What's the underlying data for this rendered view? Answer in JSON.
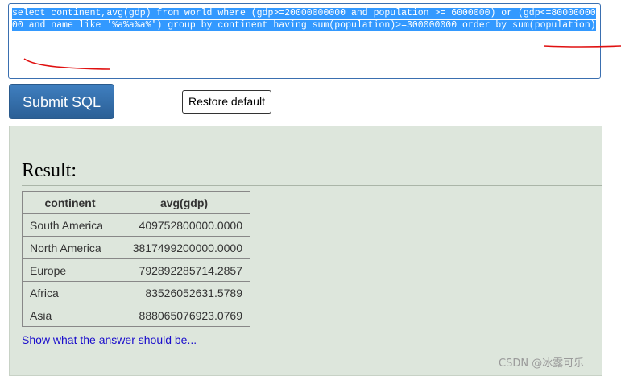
{
  "sql": {
    "query": "select continent,avg(gdp) from world where (gdp>=20000000000 and population >= 6000000) or (gdp<=8000000000 and name like '%a%a%a%') group by continent having sum(population)>=300000000 order by sum(population)"
  },
  "buttons": {
    "submit_label": "Submit SQL",
    "restore_label": "Restore default"
  },
  "result": {
    "title": "Result:",
    "columns": [
      "continent",
      "avg(gdp)"
    ],
    "rows": [
      [
        "South America",
        "409752800000.0000"
      ],
      [
        "North America",
        "3817499200000.0000"
      ],
      [
        "Europe",
        "792892285714.2857"
      ],
      [
        "Africa",
        "83526052631.5789"
      ],
      [
        "Asia",
        "888065076923.0769"
      ]
    ],
    "answer_link": "Show what the answer should be..."
  },
  "watermark": "CSDN @冰露可乐",
  "colors": {
    "selection": "#3399ff",
    "submit_button": "#2f6aa6",
    "panel_background": "#dde6dc",
    "link": "#1a0dcc",
    "ink": "#e01010"
  }
}
